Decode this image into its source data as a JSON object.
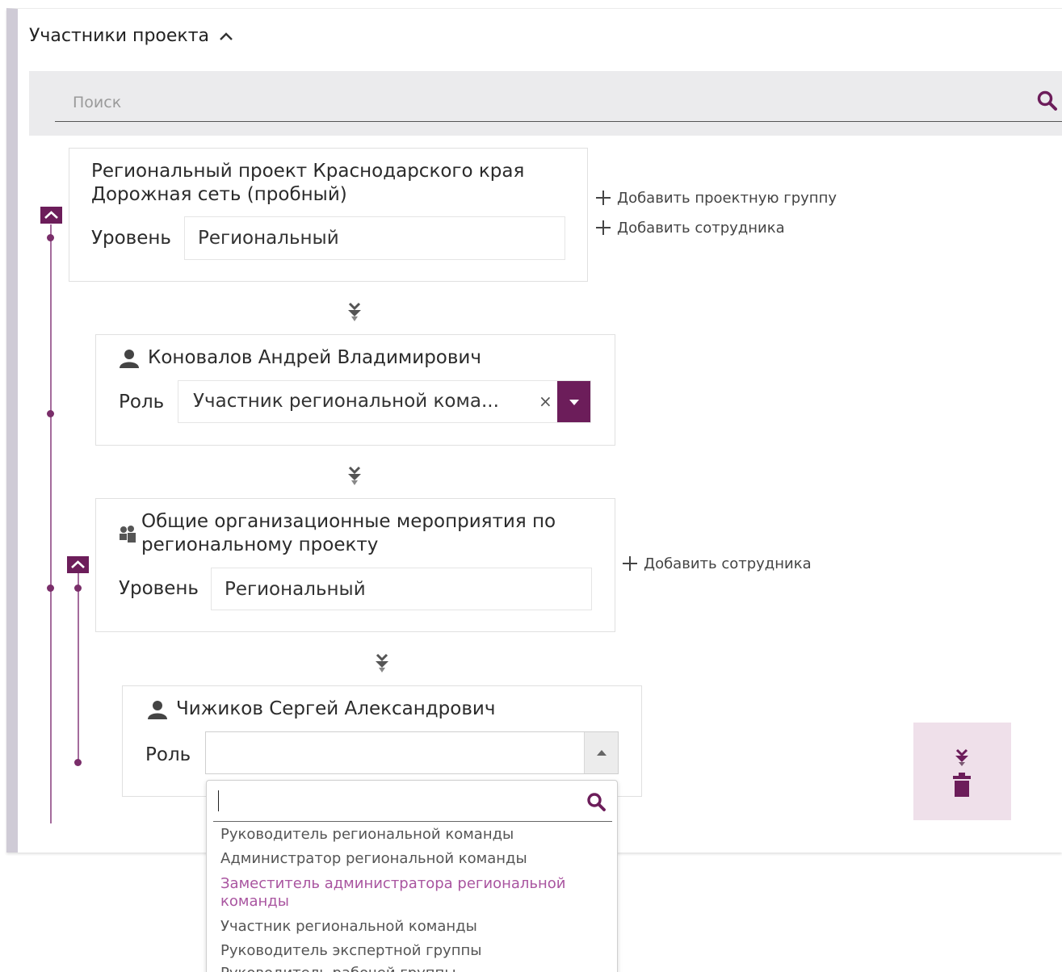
{
  "section": {
    "title": "Участники проекта"
  },
  "search": {
    "placeholder": "Поиск"
  },
  "project": {
    "title": "Региональный проект Краснодарского края Дорожная сеть (пробный)",
    "title_line1": "Региональный проект Краснодарского края",
    "title_line2": "Дорожная сеть (пробный)",
    "level_label": "Уровень",
    "level_value": "Региональный",
    "add_group": "Добавить проектную группу",
    "add_employee": "Добавить сотрудника"
  },
  "member1": {
    "name": "Коновалов Андрей Владимирович",
    "role_label": "Роль",
    "role_value": "Участник региональной кома..."
  },
  "group": {
    "title_line1": "Общие организационные мероприятия по",
    "title_line2": "региональному проекту",
    "level_label": "Уровень",
    "level_value": "Региональный",
    "add_employee": "Добавить сотрудника"
  },
  "member2": {
    "name": "Чижиков Сергей Александрович",
    "role_label": "Роль",
    "role_value": ""
  },
  "dropdown": {
    "options": [
      "Руководитель региональной команды",
      "Администратор региональной команды",
      "Заместитель администратора региональной",
      "команды",
      "Участник региональной команды",
      "Руководитель экспертной группы",
      "Руководитель рабочей группы"
    ],
    "highlighted": "Заместитель администратора региональной команды"
  },
  "colors": {
    "accent": "#6c1d5a",
    "tree": "#a46b9c",
    "highlight_text": "#a955a0",
    "action_bg": "#efe0ea"
  },
  "icons": [
    "chevron-up-icon",
    "search-icon",
    "plus-icon",
    "user-icon",
    "users-group-icon",
    "arrow-down-icon",
    "caret-down-icon",
    "caret-up-icon",
    "trash-icon"
  ]
}
